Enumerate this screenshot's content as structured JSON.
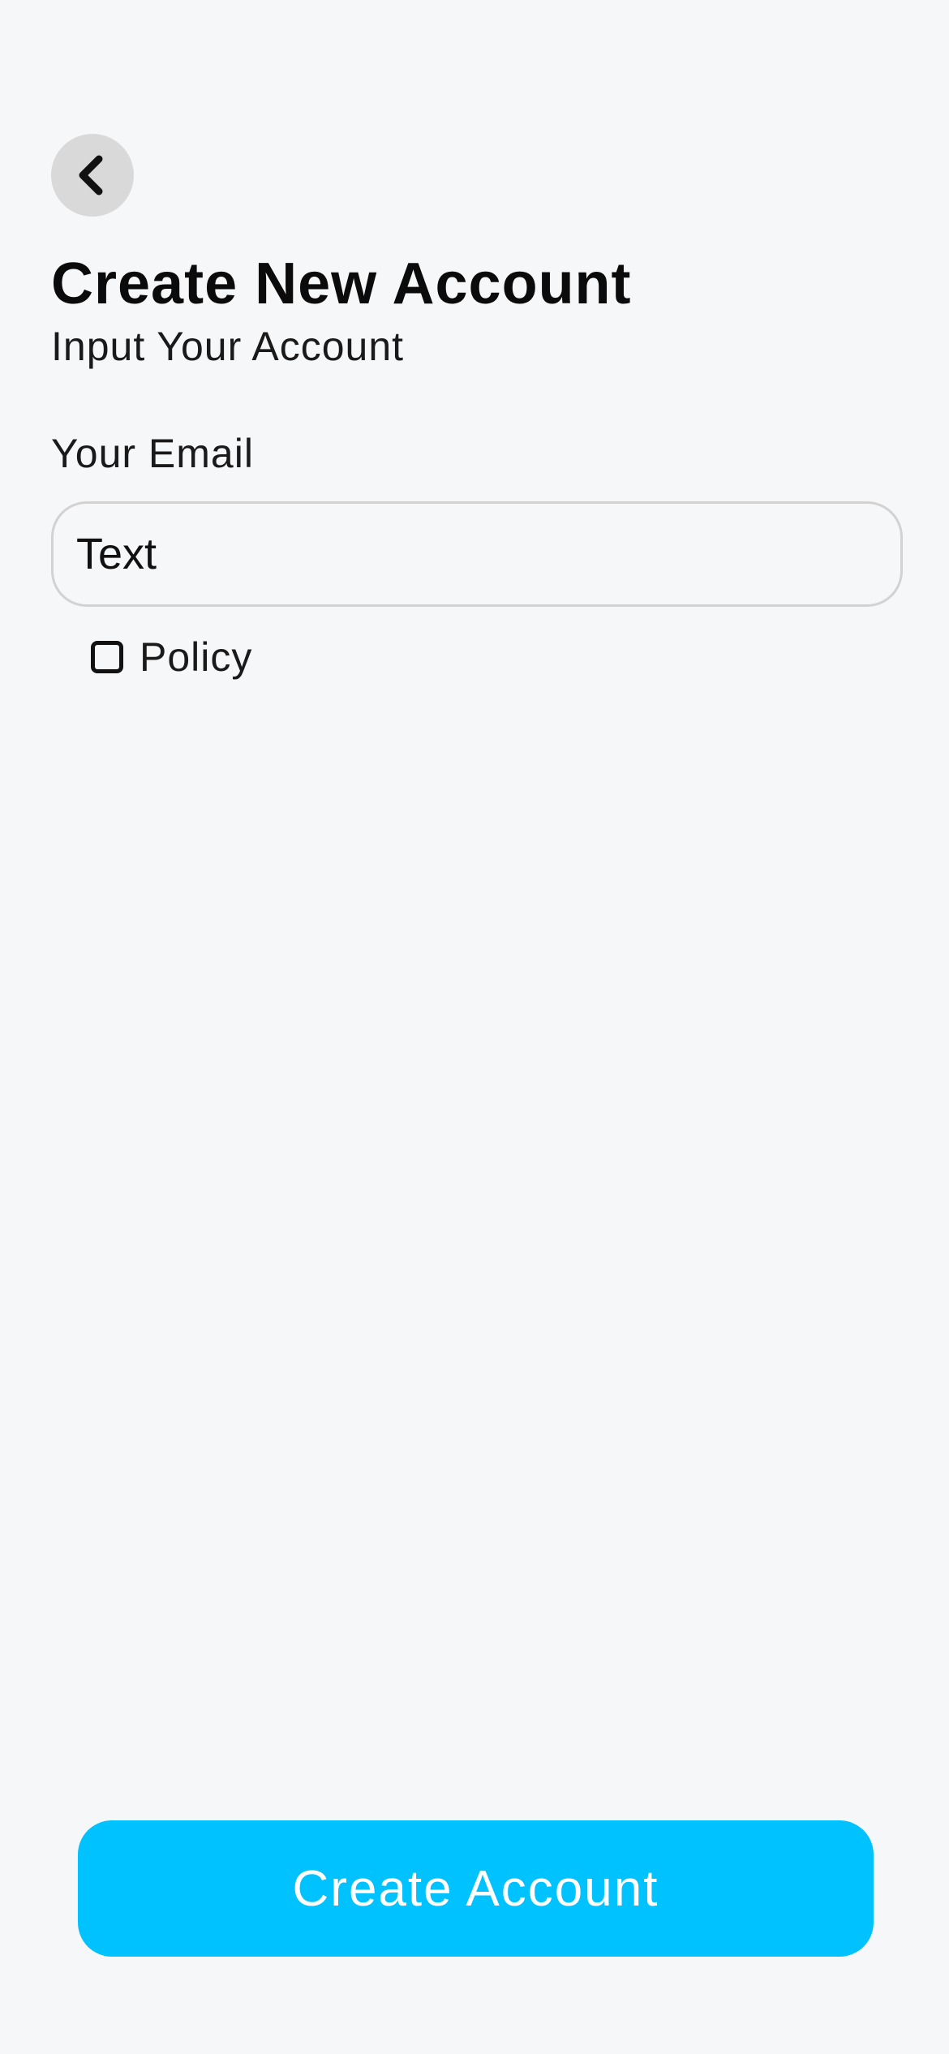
{
  "header": {
    "back_icon": "chevron-left-icon",
    "title": "Create New Account",
    "subtitle": "Input Your Account"
  },
  "form": {
    "email_label": "Your Email",
    "email_value": "Text",
    "policy_label": "Policy",
    "policy_checked": false
  },
  "actions": {
    "create_label": "Create Account"
  },
  "colors": {
    "background": "#f6f7f9",
    "back_button_bg": "#d9d9d9",
    "primary_button": "#00c2ff",
    "input_border": "#d2d2d2"
  }
}
